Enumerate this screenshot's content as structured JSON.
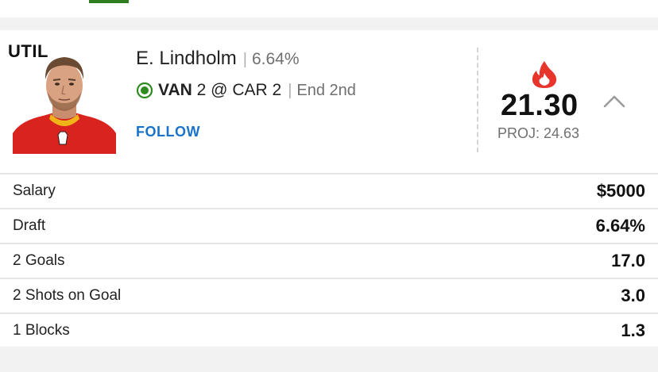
{
  "card": {
    "position": "UTIL",
    "player_name": "E. Lindholm",
    "ownership": "6.64%",
    "game": {
      "away_team": "VAN",
      "away_score": "2",
      "at": "@",
      "home_team": "CAR",
      "home_score": "2",
      "status": "End 2nd"
    },
    "follow_label": "FOLLOW",
    "points": "21.30",
    "projection": "PROJ: 24.63"
  },
  "stats": [
    {
      "label": "Salary",
      "value": "$5000"
    },
    {
      "label": "Draft",
      "value": "6.64%"
    },
    {
      "label": "2 Goals",
      "value": "17.0"
    },
    {
      "label": "2 Shots on Goal",
      "value": "3.0"
    },
    {
      "label": "1 Blocks",
      "value": "1.3"
    }
  ],
  "colors": {
    "live_green": "#2e8b1e",
    "follow_blue": "#1a73c9",
    "flame_red": "#e8352b",
    "jersey_red": "#d8231e"
  },
  "icons": {
    "live": "live-indicator-icon",
    "hot": "flame-icon",
    "collapse": "chevron-up-icon"
  }
}
